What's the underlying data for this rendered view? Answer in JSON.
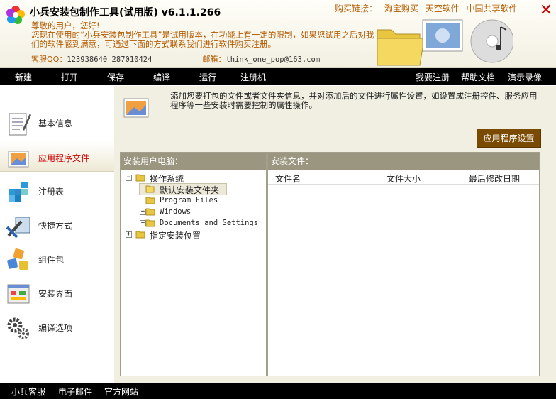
{
  "header": {
    "app_title": "小兵安装包制作工具(试用版) v6.1.1.266",
    "buy_label": "购买链接：",
    "buy_links": [
      "淘宝购买",
      "天空软件",
      "中国共享软件"
    ],
    "notice_line1": "尊敬的用户，您好!",
    "notice_line2": "您现在使用的“小兵安装包制作工具”是试用版本，在功能上有一定的限制，如果您试用之后对我们的软件感到满意，可通过下面的方式联系我们进行软件购买注册。",
    "qq_label": "客服QQ：",
    "qq_value": "123938640  287010424",
    "email_label": "邮箱：",
    "email_value": "think_one_pop@163.com"
  },
  "menu": {
    "left": [
      "新建",
      "打开",
      "保存",
      "编译",
      "运行",
      "注册机"
    ],
    "right": [
      "我要注册",
      "帮助文档",
      "演示录像"
    ]
  },
  "sidebar": {
    "items": [
      {
        "label": "基本信息",
        "icon": "notepad-icon"
      },
      {
        "label": "应用程序文件",
        "icon": "image-file-icon"
      },
      {
        "label": "注册表",
        "icon": "registry-icon"
      },
      {
        "label": "快捷方式",
        "icon": "shortcut-icon"
      },
      {
        "label": "组件包",
        "icon": "component-package-icon"
      },
      {
        "label": "安装界面",
        "icon": "install-ui-icon"
      },
      {
        "label": "编译选项",
        "icon": "gears-icon"
      }
    ],
    "active": "应用程序文件"
  },
  "main": {
    "description": "添加您要打包的文件或者文件夹信息，并对添加后的文件进行属性设置，如设置成注册控件、服务应用程序等一些安装时需要控制的属性操作。",
    "app_settings_button": "应用程序设置",
    "left_panel_title": "安装用户电脑：",
    "right_panel_title": "安装文件：",
    "tree": {
      "root1": "操作系统",
      "child1": "默认安装文件夹",
      "child2": "Program Files",
      "child3": "Windows",
      "child4": "Documents and Settings",
      "root2": "指定安装位置"
    },
    "columns": [
      "文件名",
      "文件大小",
      "最后修改日期"
    ]
  },
  "footer": {
    "links": [
      "小兵客服",
      "电子邮件",
      "官方网站"
    ]
  },
  "colors": {
    "accent_orange": "#b35a00",
    "menubar_bg": "#000000",
    "button_brown": "#7a4a00",
    "panel_header": "#9a9680"
  }
}
